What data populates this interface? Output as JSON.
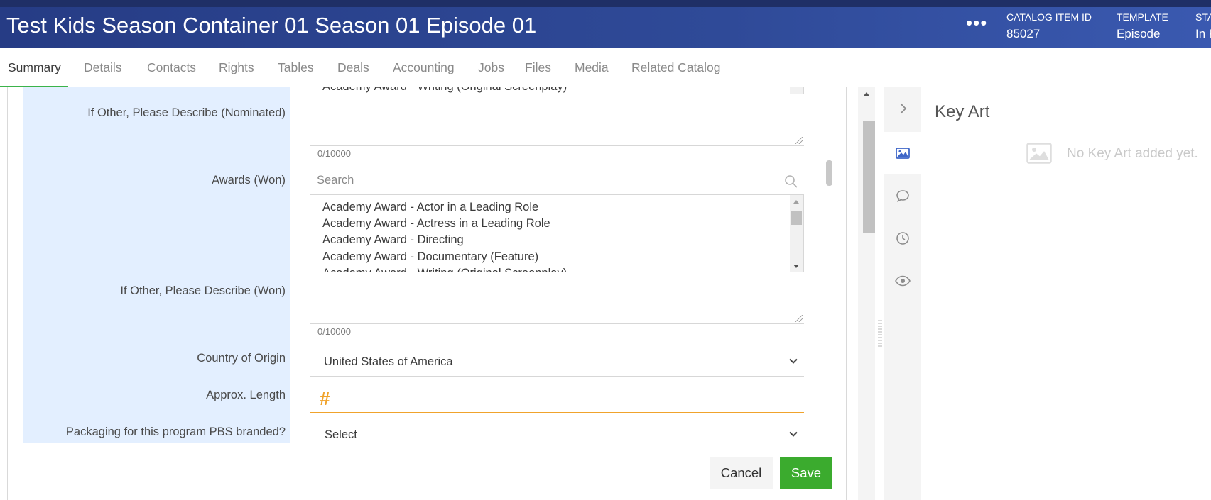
{
  "header": {
    "title": "Test Kids Season Container 01 Season 01 Episode 01",
    "more_label": "•••",
    "meta": [
      {
        "label": "CATALOG ITEM ID",
        "value": "85027"
      },
      {
        "label": "TEMPLATE",
        "value": "Episode"
      },
      {
        "label": "STA",
        "value": "In P"
      }
    ]
  },
  "tabs": [
    {
      "label": "Summary",
      "active": true
    },
    {
      "label": "Details"
    },
    {
      "label": "Contacts"
    },
    {
      "label": "Rights"
    },
    {
      "label": "Tables"
    },
    {
      "label": "Deals"
    },
    {
      "label": "Accounting"
    },
    {
      "label": "Jobs"
    },
    {
      "label": "Files"
    },
    {
      "label": "Media"
    },
    {
      "label": "Related Catalog"
    }
  ],
  "form": {
    "top_list_partial_item": "Academy Award - Writing (Original Screenplay)",
    "nominated_other": {
      "label": "If Other, Please Describe (Nominated)",
      "value": "",
      "counter": "0/10000"
    },
    "awards_won": {
      "label": "Awards (Won)",
      "search_placeholder": "Search",
      "options": [
        "Academy Award - Actor in a Leading Role",
        "Academy Award - Actress in a Leading Role",
        "Academy Award - Directing",
        "Academy Award - Documentary (Feature)",
        "Academy Award - Writing (Original Screenplay)"
      ]
    },
    "won_other": {
      "label": "If Other, Please Describe (Won)",
      "value": "",
      "counter": "0/10000"
    },
    "country": {
      "label": "Country of Origin",
      "value": "United States of America"
    },
    "approx_length": {
      "label": "Approx. Length",
      "icon": "#"
    },
    "pbs_branded": {
      "label": "Packaging for this program PBS branded?",
      "value": "Select"
    },
    "cancel_label": "Cancel",
    "save_label": "Save"
  },
  "side_panel": {
    "title": "Key Art",
    "empty_text": "No Key Art added yet.",
    "rail_icons": [
      "chevron-right-icon",
      "image-icon",
      "comment-icon",
      "clock-icon",
      "eye-icon"
    ]
  },
  "colors": {
    "header_bg": "#2f4a98",
    "label_column_bg": "#e3efff",
    "active_tab_underline": "#3bb34a",
    "save_button": "#3bab2e",
    "focus_accent": "#f0a32c"
  }
}
